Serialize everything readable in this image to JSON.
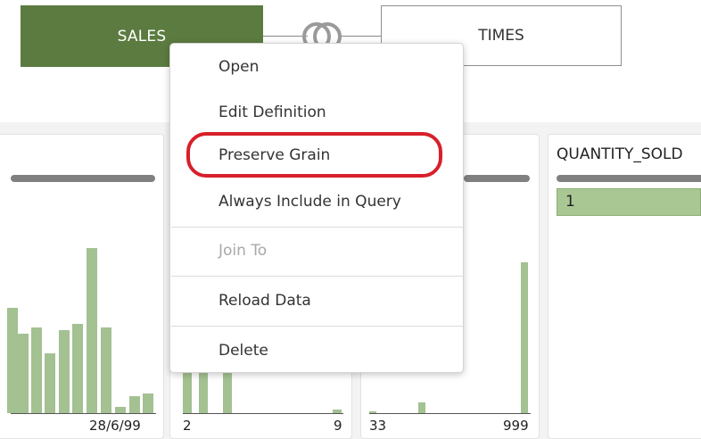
{
  "entities": {
    "sales": {
      "label": "SALES",
      "color": "#5b7b40"
    },
    "times": {
      "label": "TIMES"
    },
    "join_icon": "venn-join-icon"
  },
  "columns": [
    {
      "axis_min": "",
      "axis_max": "28/6/99",
      "histogram": [
        0.32,
        0.24,
        0.26,
        0.18,
        0.25,
        0.27,
        0.5,
        0.26,
        0.02,
        0.05,
        0.06
      ]
    },
    {
      "axis_min": "2",
      "axis_max": "9",
      "histogram": [
        0.3,
        0.3,
        0.13,
        0.01
      ]
    },
    {
      "axis_min": "33",
      "axis_max": "999",
      "histogram": [
        0.01,
        0.07,
        0.98
      ]
    },
    {
      "name": "QUANTITY_SOLD",
      "value": "1"
    }
  ],
  "context_menu": {
    "items": [
      {
        "label": "Open",
        "enabled": true
      },
      {
        "label": "Edit Definition",
        "enabled": true
      },
      {
        "label": "Preserve Grain",
        "enabled": true,
        "highlighted": true
      },
      {
        "label": "Always Include in Query",
        "enabled": true
      },
      {
        "label": "Join To",
        "enabled": false
      },
      {
        "label": "Reload Data",
        "enabled": true
      },
      {
        "label": "Delete",
        "enabled": true
      }
    ],
    "highlight_color": "#d7202b"
  },
  "colors": {
    "bar": "#a3c191",
    "value_cell": "#a9c793"
  }
}
